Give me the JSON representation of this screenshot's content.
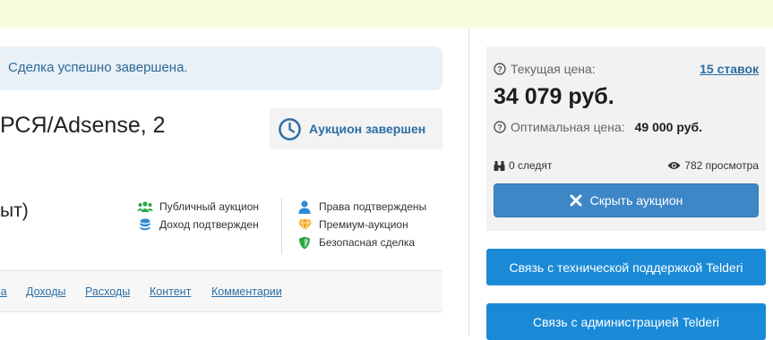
{
  "alert": {
    "text": "Сделка успешно завершена."
  },
  "lot": {
    "title": "РСЯ/Adsense, 2",
    "subtitle": "ыт)"
  },
  "status": {
    "label": "Аукцион завершен"
  },
  "features_left": [
    {
      "icon": "users-icon",
      "label": "Публичный аукцион"
    },
    {
      "icon": "coins-icon",
      "label": "Доход подтвержден"
    }
  ],
  "features_right": [
    {
      "icon": "user-icon",
      "label": "Права подтверждены"
    },
    {
      "icon": "diamond-icon",
      "label": "Премиум-аукцион"
    },
    {
      "icon": "shield-icon",
      "label": "Безопасная сделка"
    }
  ],
  "tabs": [
    "ка",
    "Доходы",
    "Расходы",
    "Контент",
    "Комментарии"
  ],
  "price_panel": {
    "current_label": "Текущая цена:",
    "bids_link": "15 ставок",
    "current_price": "34 079 руб.",
    "optimal_label": "Оптимальная цена:",
    "optimal_price": "49 000 руб.",
    "followers": "0 следят",
    "views": "782 просмотра",
    "hide_button": "Скрыть аукцион"
  },
  "support_buttons": {
    "tech": "Связь с технической поддержкой Telderi",
    "admin": "Связь с администрацией Telderi"
  },
  "colors": {
    "accent": "#2c6ea4",
    "button_blue": "#1a8ad7",
    "banner": "#f5fdde"
  }
}
